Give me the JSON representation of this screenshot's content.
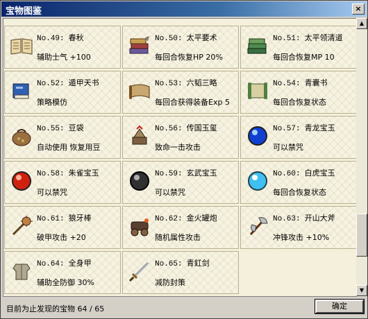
{
  "window": {
    "title": "宝物图鉴",
    "close_label": "×"
  },
  "items": [
    {
      "no": "No.49:",
      "name": "春秋",
      "effect": "辅助士气 +100",
      "icon": "open-book-icon"
    },
    {
      "no": "No.50:",
      "name": "太平要术",
      "effect": "每回合恢复HP 20%",
      "icon": "book-stack-icon"
    },
    {
      "no": "No.51:",
      "name": "太平领清道",
      "effect": "每回合恢复MP 10",
      "icon": "green-book-stack-icon"
    },
    {
      "no": "No.52:",
      "name": "遁甲天书",
      "effect": "策略模仿",
      "icon": "blue-book-icon"
    },
    {
      "no": "No.53:",
      "name": "六韬三略",
      "effect": "每回合获得装备Exp 5",
      "icon": "scroll-book-icon"
    },
    {
      "no": "No.54:",
      "name": "青囊书",
      "effect": "每回合恢复状态",
      "icon": "green-scroll-icon"
    },
    {
      "no": "No.55:",
      "name": "豆袋",
      "effect": "自动使用 恢复用豆",
      "icon": "bean-bag-icon"
    },
    {
      "no": "No.56:",
      "name": "传国玉玺",
      "effect": "致命一击攻击",
      "icon": "jade-seal-icon"
    },
    {
      "no": "No.57:",
      "name": "青龙宝玉",
      "effect": "可以禁咒",
      "icon": "blue-orb-icon"
    },
    {
      "no": "No.58:",
      "name": "朱雀宝玉",
      "effect": "可以禁咒",
      "icon": "red-orb-icon"
    },
    {
      "no": "No.59:",
      "name": "玄武宝玉",
      "effect": "可以禁咒",
      "icon": "black-orb-icon"
    },
    {
      "no": "No.60:",
      "name": "白虎宝玉",
      "effect": "每回合恢复状态",
      "icon": "white-orb-icon"
    },
    {
      "no": "No.61:",
      "name": "狼牙棒",
      "effect": "破甲攻击 +20",
      "icon": "mace-icon"
    },
    {
      "no": "No.62:",
      "name": "金火罐炮",
      "effect": "随机属性攻击",
      "icon": "cannon-icon"
    },
    {
      "no": "No.63:",
      "name": "开山大斧",
      "effect": "冲锋攻击 +10%",
      "icon": "axe-icon"
    },
    {
      "no": "No.64:",
      "name": "全身甲",
      "effect": "辅助全防御 30%",
      "icon": "armor-icon"
    },
    {
      "no": "No.65:",
      "name": "青釭剑",
      "effect": "减防封策",
      "icon": "sword-icon"
    }
  ],
  "status": "目前为止发现的宝物 64 / 65",
  "ok_label": "确定"
}
